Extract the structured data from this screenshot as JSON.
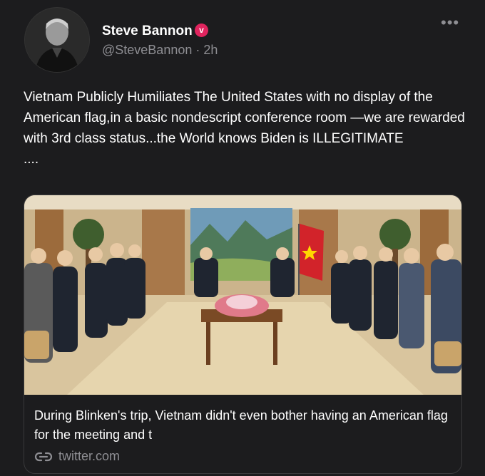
{
  "author": {
    "name": "Steve Bannon",
    "badge_icon": "verified-badge-icon",
    "badge_glyph": "v",
    "badge_color": "#e0245e",
    "handle": "@SteveBannon",
    "separator": "·",
    "time": "2h"
  },
  "more_icon": "more-options-icon",
  "more_glyph": "•••",
  "tweet": {
    "text": "Vietnam Publicly Humiliates The United States with no display of the American flag,in a basic nondescript conference room —we are rewarded with 3rd class status...the World knows Biden is ILLEGITIMATE",
    "trailing": "...."
  },
  "card": {
    "image_icon": "conference-room-photo",
    "title": "During Blinken's trip, Vietnam didn't even bother having an American flag for the meeting and t",
    "link_icon": "link-icon",
    "domain": "twitter.com"
  },
  "colors": {
    "background": "#1c1c1e",
    "secondary_text": "#8e8e93",
    "border": "#3a3a3c"
  }
}
